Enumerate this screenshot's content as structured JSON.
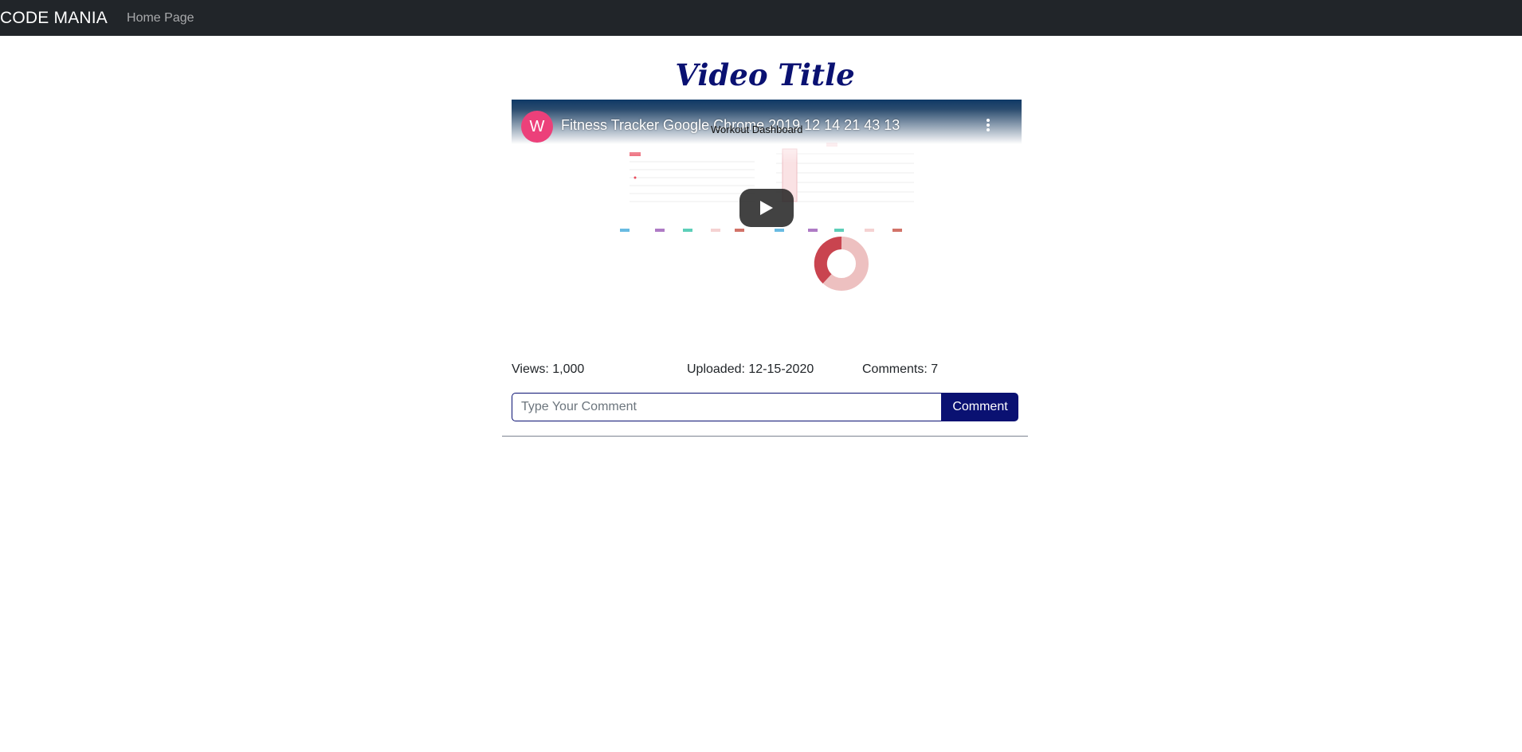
{
  "navbar": {
    "brand": "CODE MANIA",
    "home_link": "Home Page"
  },
  "page": {
    "title": "Video Title"
  },
  "video": {
    "channel_initial": "W",
    "title": "Fitness Tracker Google Chrome 2019 12 14 21 43 13",
    "dashboard_caption": "Workout Dashboard"
  },
  "stats": {
    "views": "Views: 1,000",
    "uploaded": "Uploaded: 12-15-2020",
    "comments": "Comments: 7"
  },
  "comment_form": {
    "placeholder": "Type Your Comment",
    "button_label": "Comment"
  },
  "colors": {
    "navbar_bg": "#212529",
    "accent": "#0a1172"
  }
}
